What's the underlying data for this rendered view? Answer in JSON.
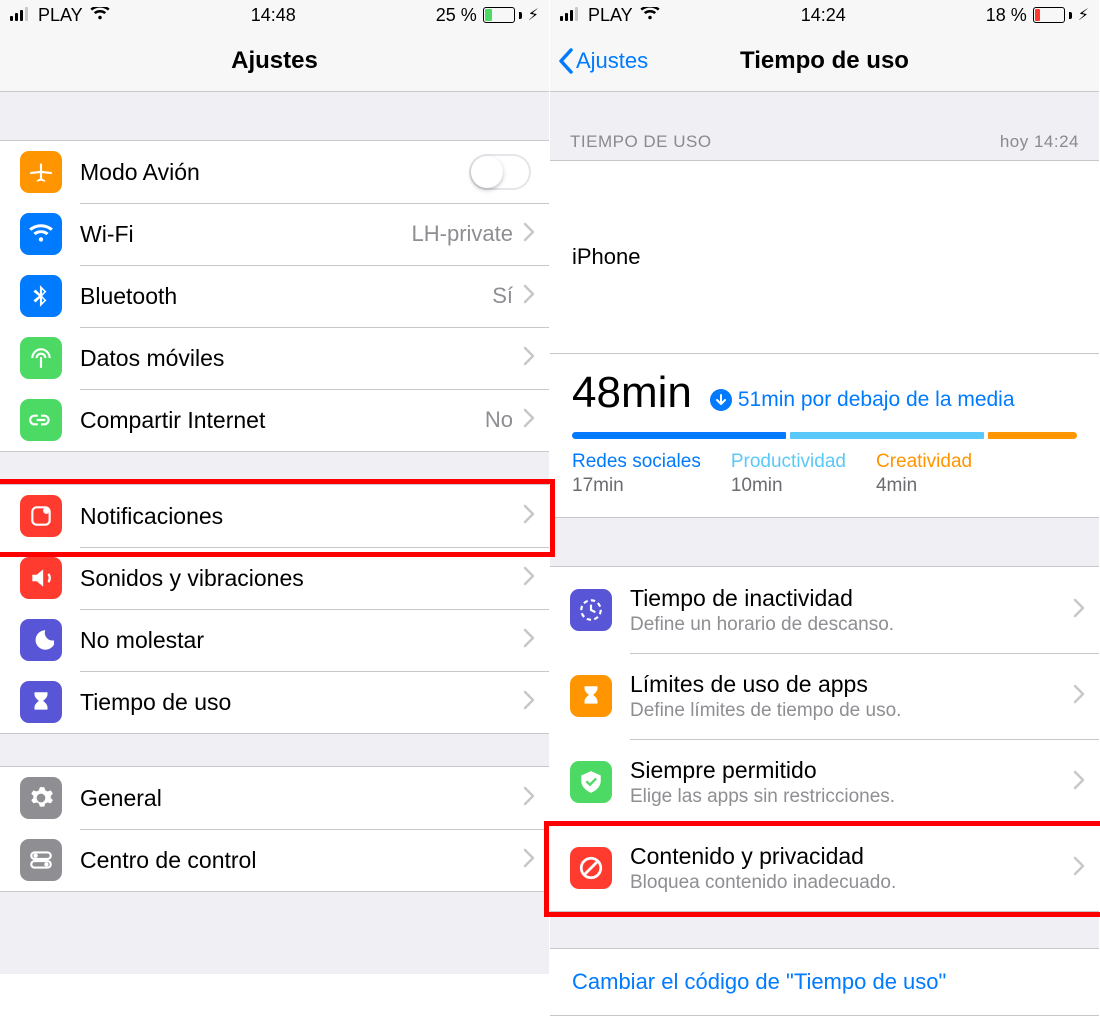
{
  "left": {
    "status": {
      "carrier": "PLAY",
      "time": "14:48",
      "battery_pct": "25 %",
      "battery_level": 0.25,
      "battery_color": "#4cd964"
    },
    "title": "Ajustes",
    "group1": [
      {
        "id": "airplane",
        "label": "Modo Avión",
        "icon_color": "#ff9500",
        "icon": "airplane",
        "toggle": false
      },
      {
        "id": "wifi",
        "label": "Wi-Fi",
        "value": "LH-private",
        "icon_color": "#007aff",
        "icon": "wifi"
      },
      {
        "id": "bluetooth",
        "label": "Bluetooth",
        "value": "Sí",
        "icon_color": "#007aff",
        "icon": "bluetooth"
      },
      {
        "id": "cellular",
        "label": "Datos móviles",
        "icon_color": "#4cd964",
        "icon": "antenna"
      },
      {
        "id": "hotspot",
        "label": "Compartir Internet",
        "value": "No",
        "icon_color": "#4cd964",
        "icon": "link"
      }
    ],
    "group2": [
      {
        "id": "notifications",
        "label": "Notificaciones",
        "icon_color": "#ff3b30",
        "icon": "notif",
        "highlight": true
      },
      {
        "id": "sounds",
        "label": "Sonidos y vibraciones",
        "icon_color": "#ff3b30",
        "icon": "sound"
      },
      {
        "id": "dnd",
        "label": "No molestar",
        "icon_color": "#5856d6",
        "icon": "moon"
      },
      {
        "id": "screentime",
        "label": "Tiempo de uso",
        "icon_color": "#5856d6",
        "icon": "hourglass"
      }
    ],
    "group3": [
      {
        "id": "general",
        "label": "General",
        "icon_color": "#8e8e93",
        "icon": "gear"
      },
      {
        "id": "controlcenter",
        "label": "Centro de control",
        "icon_color": "#8e8e93",
        "icon": "switches"
      }
    ]
  },
  "right": {
    "status": {
      "carrier": "PLAY",
      "time": "14:24",
      "battery_pct": "18 %",
      "battery_level": 0.18,
      "battery_color": "#ff3b30"
    },
    "back": "Ajustes",
    "title": "Tiempo de uso",
    "section_header": "TIEMPO DE USO",
    "section_time": "hoy 14:24",
    "device": "iPhone",
    "total": "48min",
    "delta": "51min por debajo de la media",
    "categories": [
      {
        "name": "Redes sociales",
        "value": "17min",
        "color": "#007aff",
        "width": 43
      },
      {
        "name": "Productividad",
        "value": "10min",
        "color": "#5ac8fa",
        "width": 39
      },
      {
        "name": "Creatividad",
        "value": "4min",
        "color": "#ff9500",
        "width": 18
      }
    ],
    "options": [
      {
        "id": "downtime",
        "label": "Tiempo de inactividad",
        "sub": "Define un horario de descanso.",
        "icon_color": "#5856d6",
        "icon": "downtime"
      },
      {
        "id": "applimits",
        "label": "Límites de uso de apps",
        "sub": "Define límites de tiempo de uso.",
        "icon_color": "#ff9500",
        "icon": "hourglass"
      },
      {
        "id": "allowed",
        "label": "Siempre permitido",
        "sub": "Elige las apps sin restricciones.",
        "icon_color": "#4cd964",
        "icon": "check"
      },
      {
        "id": "content",
        "label": "Contenido y privacidad",
        "sub": "Bloquea contenido inadecuado.",
        "icon_color": "#ff3b30",
        "icon": "nosign",
        "highlight": true
      }
    ],
    "change_code": "Cambiar el código de \"Tiempo de uso\""
  }
}
